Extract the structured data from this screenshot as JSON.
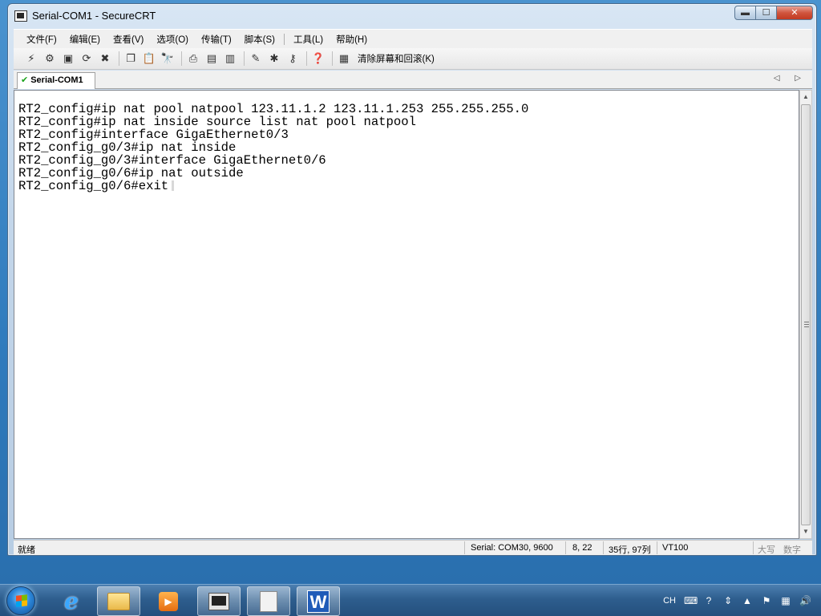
{
  "window": {
    "title": "Serial-COM1 - SecureCRT",
    "min_glyph": "▬",
    "max_glyph": "☐",
    "close_glyph": "✕"
  },
  "menu": {
    "items": [
      {
        "label": "文件(F)"
      },
      {
        "label": "编辑(E)"
      },
      {
        "label": "查看(V)"
      },
      {
        "label": "选项(O)"
      },
      {
        "label": "传输(T)"
      },
      {
        "label": "脚本(S)"
      },
      {
        "label": "工具(L)"
      },
      {
        "label": "帮助(H)"
      }
    ]
  },
  "toolbar": {
    "icons": [
      "connect-icon",
      "quick-connect-icon",
      "connect-tab-icon",
      "reconnect-icon",
      "disconnect-icon",
      "copy-icon",
      "paste-icon",
      "find-icon",
      "print-icon",
      "print-setup-icon",
      "print-selection-icon",
      "session-options-icon",
      "global-options-icon",
      "keymap-icon",
      "help-icon",
      "clear-screen-icon"
    ],
    "clear_label": "清除屏幕和回滚(K)"
  },
  "tabs": {
    "active": "Serial-COM1",
    "arrows": "◁ ▷"
  },
  "terminal": {
    "lines": [
      "RT2_config#ip nat pool natpool 123.11.1.2 123.11.1.253 255.255.255.0",
      "RT2_config#ip nat inside source list nat pool natpool",
      "RT2_config#interface GigaEthernet0/3",
      "RT2_config_g0/3#ip nat inside",
      "RT2_config_g0/3#interface GigaEthernet0/6",
      "RT2_config_g0/6#ip nat outside",
      "RT2_config_g0/6#exit"
    ]
  },
  "status": {
    "ready": "就绪",
    "serial": "Serial: COM30, 9600",
    "cursor_pos": "8,  22",
    "size": "35行, 97列",
    "terminal_type": "VT100",
    "caps": "大写",
    "num": "数字"
  },
  "taskbar": {
    "tray_lang": "CH"
  }
}
